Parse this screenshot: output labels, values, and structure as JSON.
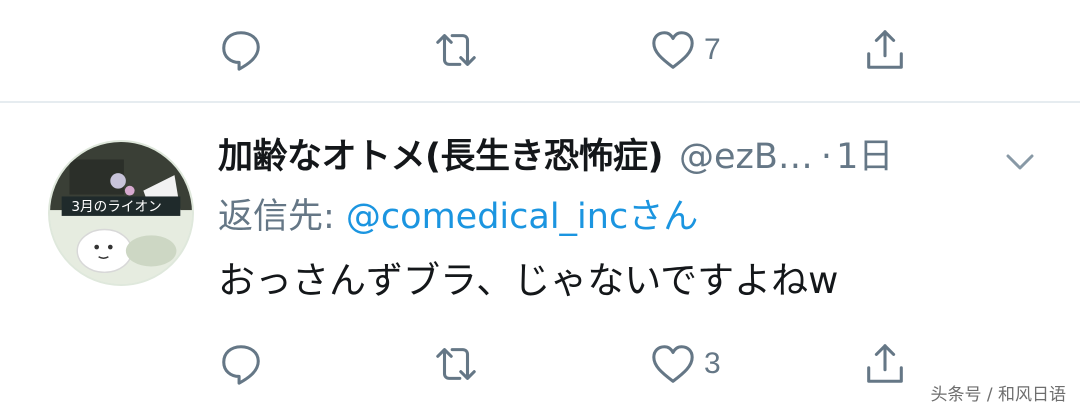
{
  "colors": {
    "text_primary": "#14171a",
    "text_secondary": "#657786",
    "link": "#1b95e0",
    "divider": "#e6ecf0"
  },
  "top_tweet_actions": {
    "reply_icon": "reply-icon",
    "retweet_icon": "retweet-icon",
    "like_icon": "heart-icon",
    "like_count": "7",
    "share_icon": "share-icon"
  },
  "tweet": {
    "display_name": "加齢なオトメ(長生き恐怖症)",
    "handle": "@ezB…",
    "separator": "·",
    "time": "1日",
    "menu_icon": "chevron-down-icon",
    "reply_prefix": "返信先: ",
    "reply_mention": "@comedical_inc",
    "reply_suffix": "さん",
    "text": "おっさんずブラ、じゃないですよねw",
    "avatar_text": "3月のライオン",
    "actions": {
      "reply_icon": "reply-icon",
      "retweet_icon": "retweet-icon",
      "like_icon": "heart-icon",
      "like_count": "3",
      "share_icon": "share-icon"
    }
  },
  "watermark": "头条号 / 和风日语"
}
